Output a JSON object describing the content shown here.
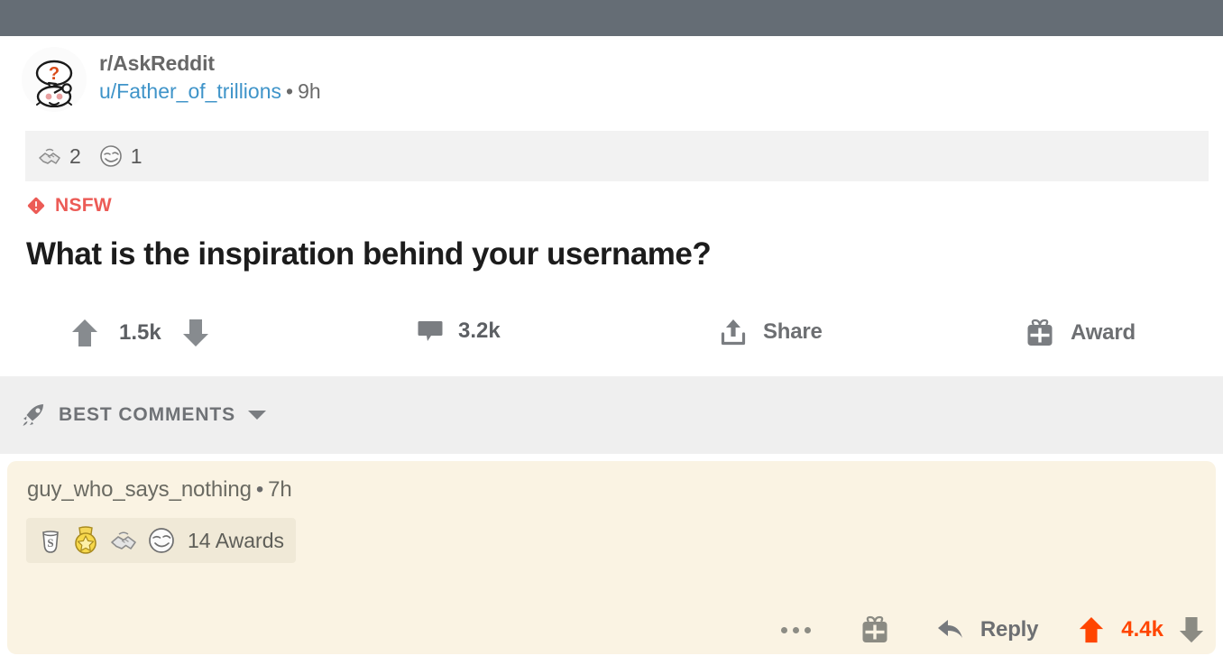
{
  "post": {
    "subreddit": "r/AskReddit",
    "author": "u/Father_of_trillions",
    "separator": "•",
    "age": "9h",
    "nsfw_label": "NSFW",
    "title": "What is the inspiration behind your username?",
    "awards": [
      {
        "icon": "handshake-award-icon",
        "count": "2"
      },
      {
        "icon": "smiley-award-icon",
        "count": "1"
      }
    ],
    "actions": {
      "upvote_icon": "upvote-arrow-icon",
      "score": "1.5k",
      "downvote_icon": "downvote-arrow-icon",
      "comments_icon": "comment-bubble-icon",
      "comments_count": "3.2k",
      "share_icon": "share-upload-icon",
      "share_label": "Share",
      "award_icon": "gift-box-icon",
      "award_label": "Award"
    }
  },
  "sort": {
    "icon": "rocket-icon",
    "label": "BEST COMMENTS",
    "chevron": "chevron-down-icon"
  },
  "comment": {
    "author": "guy_who_says_nothing",
    "separator": "•",
    "age": "7h",
    "awards_icons": [
      "silver-s-award-icon",
      "gold-star-medal-award-icon",
      "handshake-award-icon",
      "smiley-award-icon"
    ],
    "awards_label": "14 Awards",
    "actions": {
      "overflow_icon": "more-options-icon",
      "gift_icon": "gift-box-icon",
      "reply_icon": "reply-arrow-icon",
      "reply_label": "Reply",
      "upvote_icon": "upvote-arrow-icon",
      "score": "4.4k",
      "downvote_icon": "downvote-arrow-icon"
    }
  },
  "colors": {
    "topbar": "#656d75",
    "accent_orange": "#ff4500",
    "nsfw_red": "#ec5b56",
    "link_blue": "#3f94c9",
    "comment_bg": "#faf3e3",
    "sortbar_bg": "#efefef",
    "award_pill_bg": "#f2f2f2"
  }
}
